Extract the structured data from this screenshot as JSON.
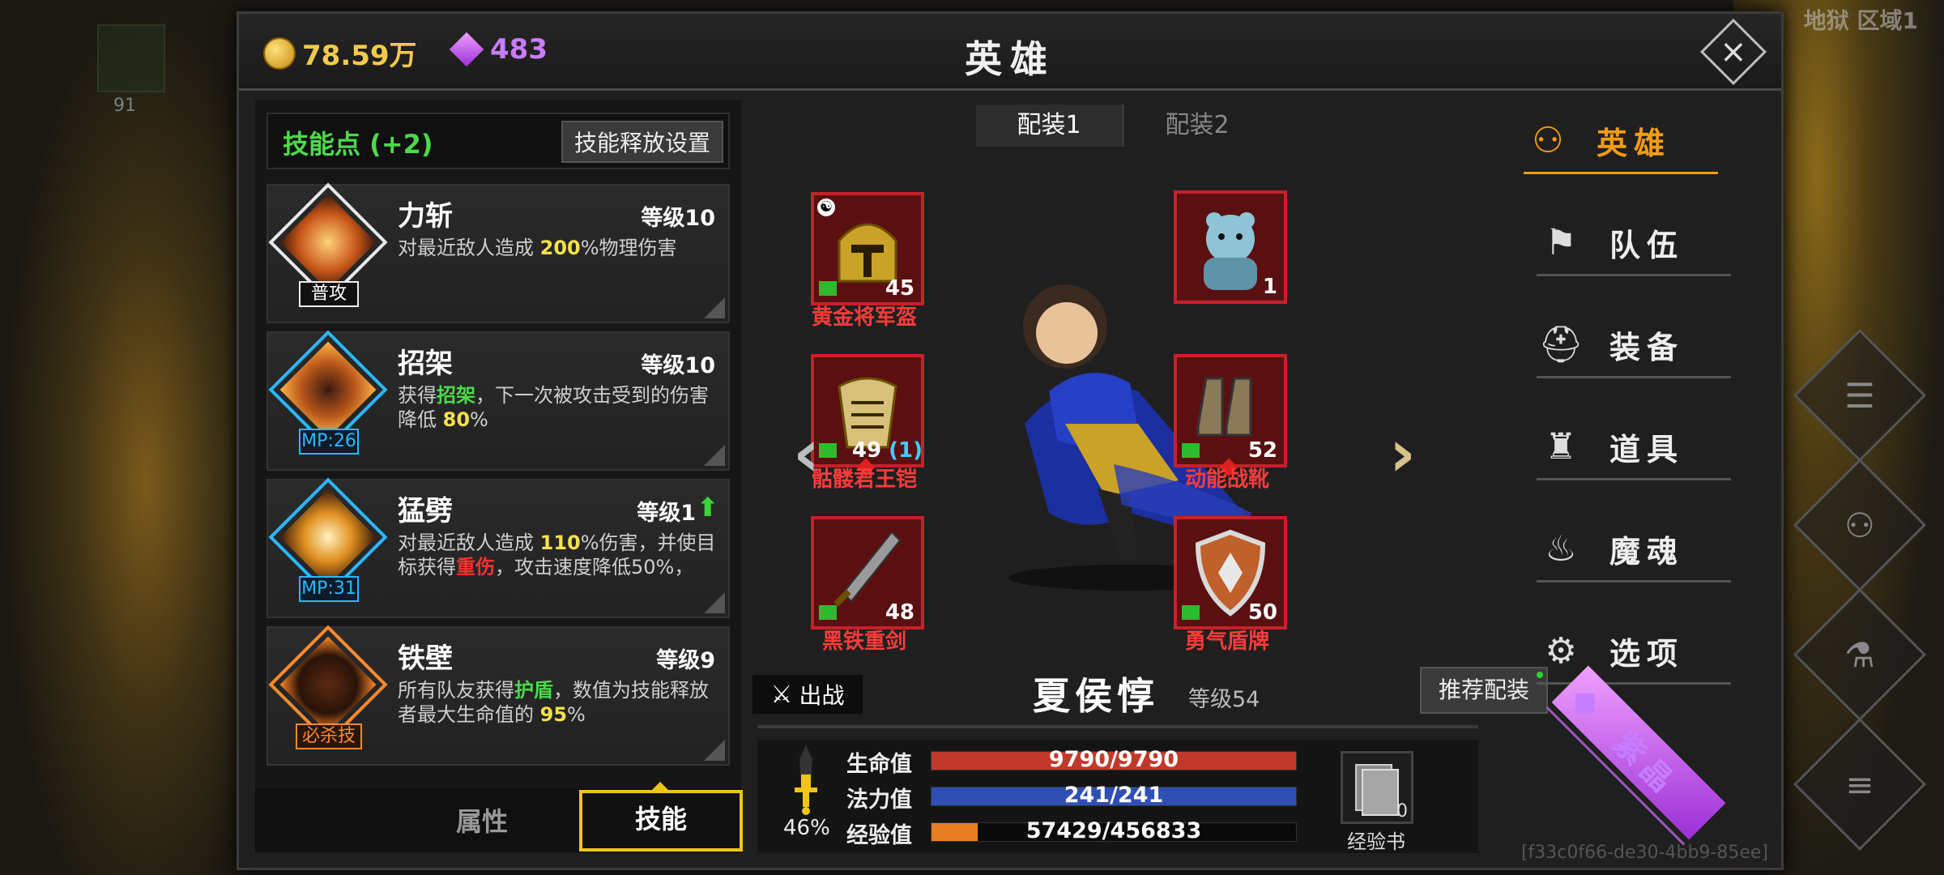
{
  "background": {
    "minimap_count": "91",
    "zone": "地狱 区域1"
  },
  "header": {
    "gold": "78.59万",
    "gems": "483",
    "title": "英雄"
  },
  "skills": {
    "skill_points": "技能点 (+2)",
    "release_settings": "技能释放设置",
    "items": [
      {
        "name": "力斩",
        "level": "等级10",
        "tag": "普攻",
        "desc_pre": "对最近敌人造成 ",
        "desc_hl1": "200",
        "desc_mid": "%物理伤害",
        "desc_hl2": "",
        "desc_post": ""
      },
      {
        "name": "招架",
        "level": "等级10",
        "tag": "MP:26",
        "desc_pre": "获得",
        "desc_hl1": "招架",
        "desc_mid": "，下一次被攻击受到的伤害降低 ",
        "desc_hl2": "80",
        "desc_post": "%"
      },
      {
        "name": "猛劈",
        "level": "等级1",
        "tag": "MP:31",
        "desc_pre": "对最近敌人造成 ",
        "desc_hl1": "110",
        "desc_mid": "%伤害，并使目标获得",
        "desc_hl2": "重伤",
        "desc_post": "，攻击速度降低50%，"
      },
      {
        "name": "铁壁",
        "level": "等级9",
        "tag": "必杀技",
        "desc_pre": "所有队友获得",
        "desc_hl1": "护盾",
        "desc_mid": "，数值为技能释放者最大生命值的 ",
        "desc_hl2": "95",
        "desc_post": "%"
      }
    ],
    "tab_attributes": "属性",
    "tab_skills": "技能"
  },
  "equipment": {
    "loadout_tabs": [
      "配装1",
      "配装2"
    ],
    "slots": [
      {
        "name": "黄金将军盔",
        "count": "45",
        "extra": ""
      },
      {
        "name": "",
        "count": "1",
        "extra": ""
      },
      {
        "name": "骷髅君王铠",
        "count": "49",
        "extra": "(1)"
      },
      {
        "name": "动能战靴",
        "count": "52",
        "extra": ""
      },
      {
        "name": "黑铁重剑",
        "count": "48",
        "extra": ""
      },
      {
        "name": "勇气盾牌",
        "count": "50",
        "extra": ""
      }
    ],
    "deploy": "出战",
    "hero_name": "夏侯惇",
    "hero_level": "等级54",
    "recommend": "推荐配装"
  },
  "stats": {
    "percent": "46%",
    "hp_label": "生命值",
    "hp": "9790/9790",
    "hp_fill": 1.0,
    "mp_label": "法力值",
    "mp": "241/241",
    "mp_fill": 1.0,
    "exp_label": "经验值",
    "exp": "57429/456833",
    "exp_fill": 0.1257,
    "exp_book_count": "0",
    "exp_book_label": "经验书",
    "uid": "[f33c0f66-de30-4bb9-85ee]"
  },
  "nav": {
    "items": [
      "英雄",
      "队伍",
      "装备",
      "道具",
      "魔魂",
      "选项",
      "紫晶"
    ]
  },
  "colors": {
    "hp": "#c0392b",
    "mp": "#2f4fb5",
    "exp": "#e67e22",
    "accent": "#f39c12",
    "gem": "#c77dff"
  }
}
